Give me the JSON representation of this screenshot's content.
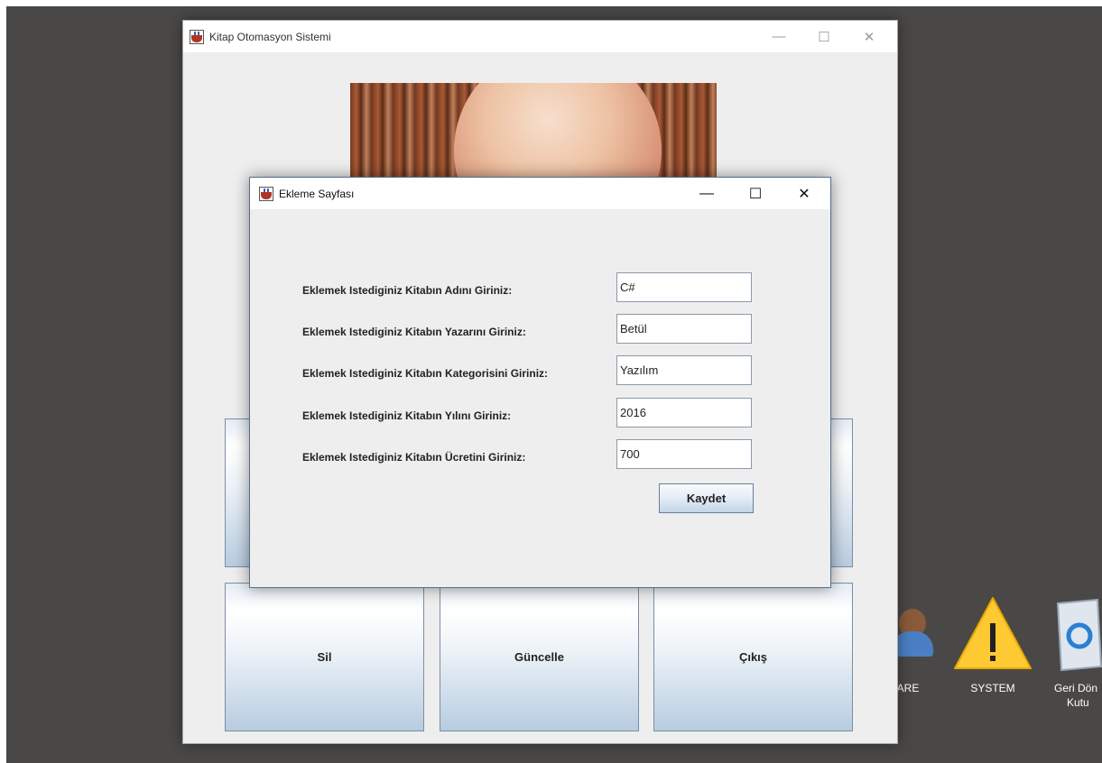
{
  "main_window": {
    "title": "Kitap Otomasyon Sistemi",
    "controls": {
      "minimize": "—",
      "maximize": "☐",
      "close": "✕"
    },
    "buttons": [
      {
        "label": ""
      },
      {
        "label": ""
      },
      {
        "label": "Sil"
      },
      {
        "label": "Güncelle"
      },
      {
        "label": "Çıkış"
      }
    ]
  },
  "dialog": {
    "title": "Ekleme Sayfası",
    "controls": {
      "minimize": "—",
      "maximize": "☐",
      "close": "✕"
    },
    "fields": [
      {
        "label": "Eklemek Istediginiz Kitabın Adını Giriniz:",
        "value": "C#"
      },
      {
        "label": "Eklemek Istediginiz Kitabın Yazarını Giriniz:",
        "value": "Betül"
      },
      {
        "label": "Eklemek Istediginiz Kitabın Kategorisini Giriniz:",
        "value": "Yazılım"
      },
      {
        "label": "Eklemek Istediginiz Kitabın Yılını Giriniz:",
        "value": "2016"
      },
      {
        "label": "Eklemek Istediginiz Kitabın Ücretini Giriniz:",
        "value": "700"
      }
    ],
    "save_label": "Kaydet"
  },
  "desktop": {
    "icons": [
      {
        "label": "ARE",
        "icon": "user-icon"
      },
      {
        "label": "SYSTEM",
        "icon": "warning-icon"
      },
      {
        "label": "Geri Dönüşüm Kutusu",
        "icon": "recycle-bin-icon",
        "visible_label": "Geri Dön Kutu"
      }
    ]
  }
}
